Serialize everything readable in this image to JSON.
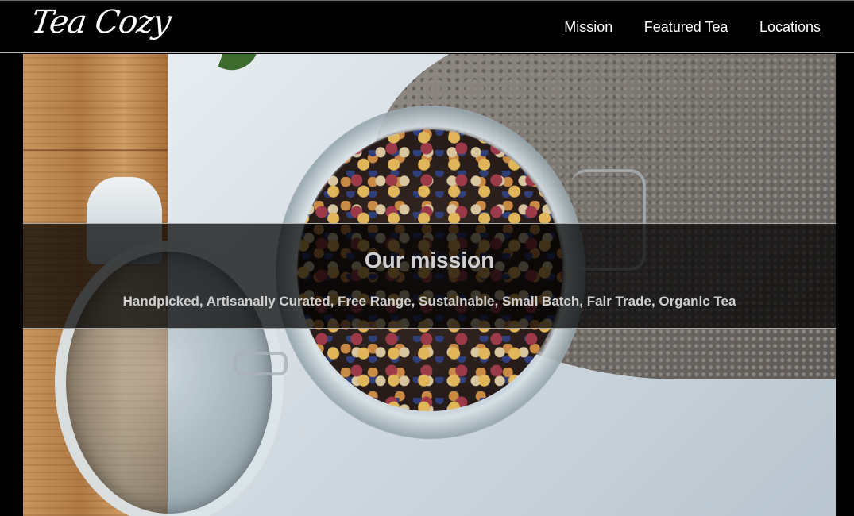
{
  "header": {
    "logo_text": "Tea Cozy",
    "nav": [
      {
        "label": "Mission"
      },
      {
        "label": "Featured Tea"
      },
      {
        "label": "Locations"
      }
    ]
  },
  "hero": {
    "image_subject": "open glass jar of loose-leaf tea",
    "mission_title": "Our mission",
    "mission_text": "Handpicked, Artisanally Curated, Free Range, Sustainable, Small Batch, Fair Trade, Organic Tea"
  },
  "colors": {
    "background": "#000000",
    "header_text": "#ffffff",
    "band_text": "#cfcfcf"
  }
}
